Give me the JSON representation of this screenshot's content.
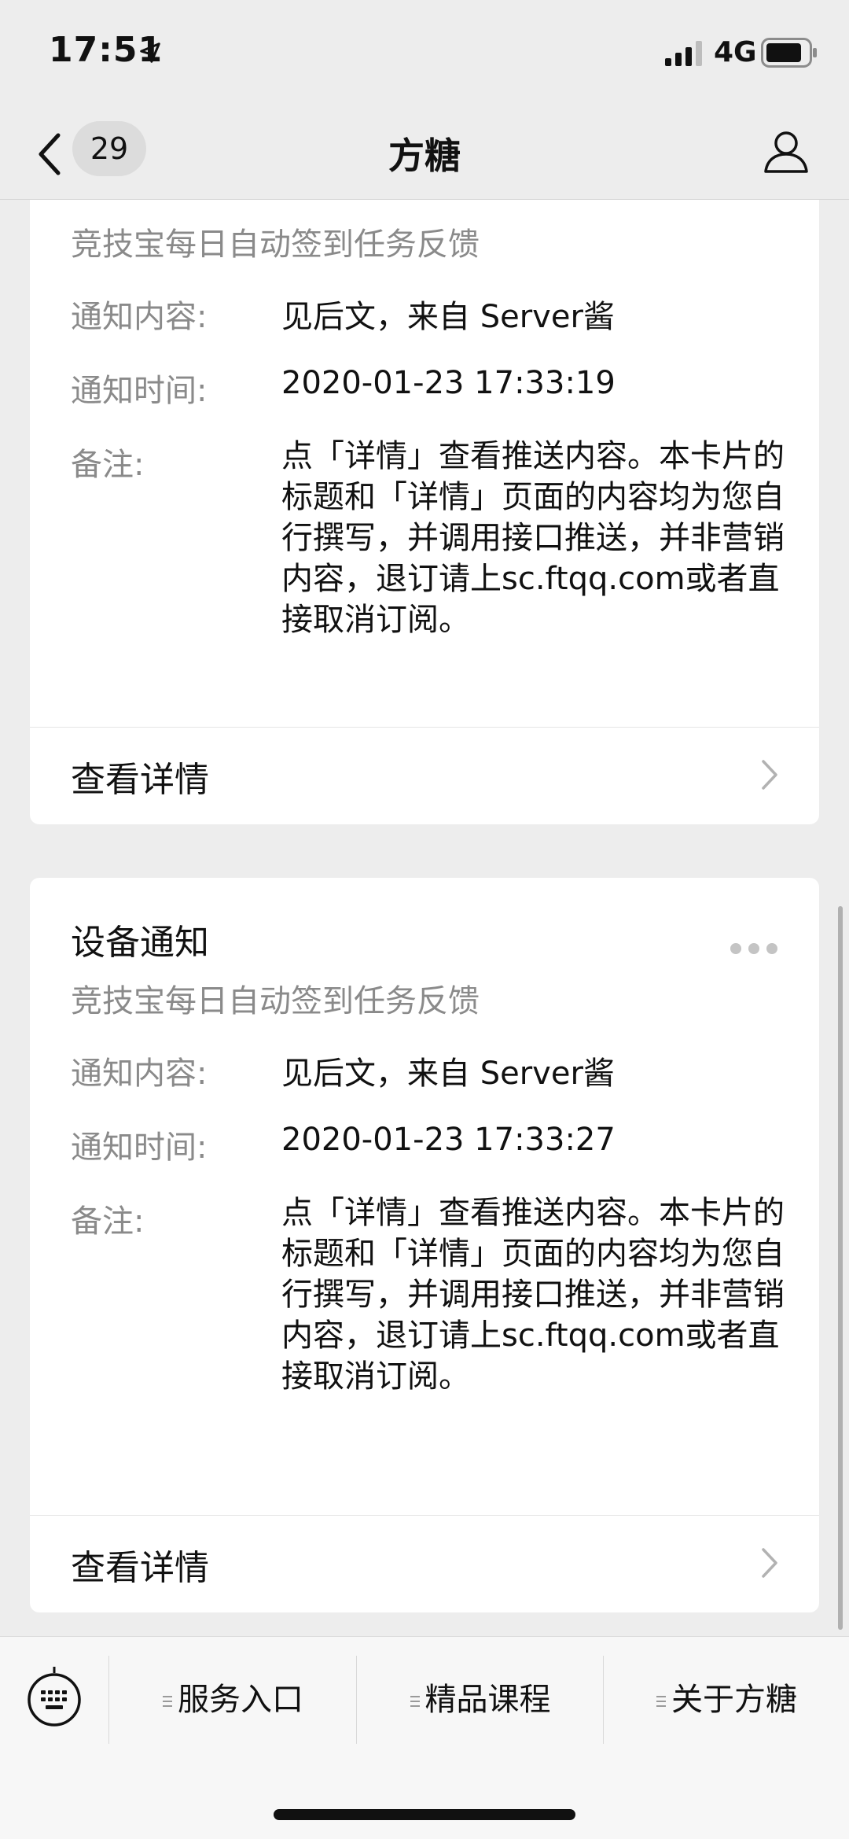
{
  "status_bar": {
    "time": "17:51",
    "network": "4G"
  },
  "nav": {
    "unread_count": "29",
    "title": "方糖"
  },
  "cards": [
    {
      "subtitle": "竞技宝每日自动签到任务反馈",
      "content_label": "通知内容:",
      "content_value": "见后文，来自 Server酱",
      "time_label": "通知时间:",
      "time_value": "2020-01-23 17:33:19",
      "remark_label": "备注:",
      "remark_value": "点「详情」查看推送内容。本卡片的标题和「详情」页面的内容均为您自行撰写，并调用接口推送，并非营销内容，退订请上sc.ftqq.com或者直接取消订阅。",
      "detail_label": "查看详情"
    },
    {
      "title": "设备通知",
      "subtitle": "竞技宝每日自动签到任务反馈",
      "content_label": "通知内容:",
      "content_value": "见后文，来自 Server酱",
      "time_label": "通知时间:",
      "time_value": "2020-01-23 17:33:27",
      "remark_label": "备注:",
      "remark_value": "点「详情」查看推送内容。本卡片的标题和「详情」页面的内容均为您自行撰写，并调用接口推送，并非营销内容，退订请上sc.ftqq.com或者直接取消订阅。",
      "detail_label": "查看详情"
    }
  ],
  "menu": {
    "items": [
      "服务入口",
      "精品课程",
      "关于方糖"
    ]
  },
  "icons": {
    "location": "location-arrow-icon",
    "signal": "signal-bars-icon",
    "battery": "battery-icon",
    "back": "chevron-left-icon",
    "profile": "person-icon",
    "more": "more-dots-icon",
    "chevron": "chevron-right-icon",
    "keyboard": "keyboard-icon",
    "menu": "menu-lines-icon"
  },
  "colors": {
    "background": "#ededed",
    "card": "#ffffff",
    "secondary_text": "#8a8a8a"
  }
}
